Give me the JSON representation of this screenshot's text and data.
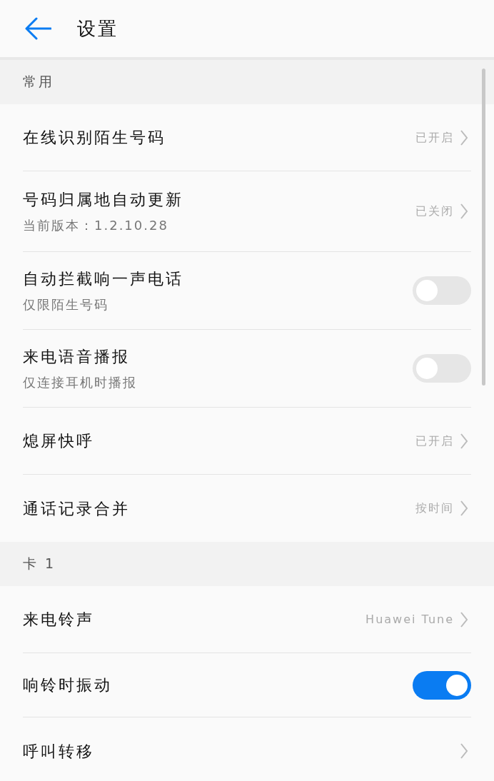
{
  "header": {
    "title": "设置"
  },
  "sections": [
    {
      "title": "常用",
      "items": [
        {
          "kind": "link",
          "label": "在线识别陌生号码",
          "value": "已开启"
        },
        {
          "kind": "link",
          "label": "号码归属地自动更新",
          "subtitle": "当前版本：1.2.10.28",
          "value": "已关闭"
        },
        {
          "kind": "toggle",
          "label": "自动拦截响一声电话",
          "subtitle": "仅限陌生号码",
          "on": false
        },
        {
          "kind": "toggle",
          "label": "来电语音播报",
          "subtitle": "仅连接耳机时播报",
          "on": false
        },
        {
          "kind": "link",
          "label": "熄屏快呼",
          "value": "已开启"
        },
        {
          "kind": "link",
          "label": "通话记录合并",
          "value": "按时间"
        }
      ]
    },
    {
      "title": "卡 1",
      "items": [
        {
          "kind": "link",
          "label": "来电铃声",
          "value": "Huawei Tune"
        },
        {
          "kind": "toggle",
          "label": "响铃时振动",
          "on": true
        },
        {
          "kind": "link",
          "label": "呼叫转移"
        }
      ]
    }
  ]
}
